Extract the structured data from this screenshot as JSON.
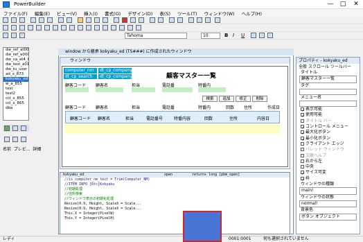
{
  "window": {
    "title": "PowerBuilder",
    "min": "—",
    "max": "□",
    "close": "✕"
  },
  "menu": [
    "ファイル(F)",
    "編集(E)",
    "ビュー(V)",
    "挿入(I)",
    "書式(O)",
    "デザイン(D)",
    "表(S)",
    "ツール(T)",
    "ウィンドウ(W)",
    "ヘルプ(H)"
  ],
  "toolbar": {
    "font": "Tahoma",
    "size": "10"
  },
  "tree": [
    "dw_ref_at00.srw",
    "dw_ref_a0002",
    "dw_ca_at4_tsl",
    "dw_test_a01",
    "dw_tu_user",
    "ad_x_873",
    "kokyaku_ed",
    "w_a_855",
    "test",
    "test2",
    "ccl_x_855",
    "ccl_x_865",
    "dba"
  ],
  "tree_selected": 6,
  "left_panel": {
    "label1": "名前",
    "label2": "プレビ...",
    "label3": "詳細"
  },
  "inner": {
    "title": "window から継承 kokyaku_ed (TS###) に作成されたウィンドウ",
    "left_name": "ウィンドウ"
  },
  "form": {
    "title": "顧客マスター一覧",
    "tabs": [
      "computer_nm",
      "dt_cp_company_"
    ],
    "tab2": [
      "dt_cp_search",
      "dt_cp_company_"
    ],
    "row1": [
      "顧客コード",
      "顧客名",
      "担当",
      "電話番",
      "特番内"
    ],
    "row2": [
      "顧客コード",
      "顧客名",
      "担当",
      "電話番",
      "特番内",
      "回数",
      "住所",
      "作成日"
    ],
    "buttons": [
      "検索",
      "追加",
      "修正",
      "削除"
    ],
    "grid_headers": [
      "顧客コード",
      "顧客名",
      "担当",
      "電話番号",
      "特番内容",
      "回数",
      "住所",
      "内容日"
    ]
  },
  "code": {
    "header": "kokyaku_ed",
    "event": "open",
    "return": "returns long [pbm_open]",
    "lines": [
      "//is_computer_nm_text = Trim(Computer_NM)",
      "//ITEM INFO [Rtc]Kokyaku",
      "",
      "//初期処理",
      "//住所検索",
      "//ウィンドウ表示の初期化処理",
      "",
      "Resize(0.9, Height, ScaleX = Scale...",
      "Resize(0.9, Height, ScaleX = Scale...",
      "This.X = Integer(PixelW)",
      "This.Y = Integer(PixelH)"
    ]
  },
  "props": {
    "title": "プロパティ - kokyaku_ed",
    "tabs": [
      "全般",
      "スクロール",
      "ツールバー"
    ],
    "fields": [
      "タイトル",
      "顧客マスター一覧",
      "タグ",
      "",
      "メニュー名"
    ],
    "checks": [
      {
        "label": "表示可能",
        "on": true
      },
      {
        "label": "使用可能",
        "on": true
      },
      {
        "label": "タイトル バー",
        "on": false
      },
      {
        "label": "コントロール メニュー",
        "on": true
      },
      {
        "label": "最大化ボタン",
        "on": true
      },
      {
        "label": "最小化ボタン",
        "on": true
      },
      {
        "label": "クライアント エッジ",
        "on": false
      },
      {
        "label": "パレット ウィンドウ",
        "on": false
      },
      {
        "label": "文脈ヘルプ",
        "on": false
      },
      {
        "label": "右から左",
        "on": false
      },
      {
        "label": "中央",
        "on": false
      },
      {
        "label": "サイズ可変",
        "on": true
      },
      {
        "label": "枠",
        "on": true
      }
    ],
    "wintype_label": "ウィンドウの種類",
    "wintype": "main!",
    "winstate_label": "ウィンドウの状態",
    "winstate": "normal!",
    "bgcolor_label": "背景色",
    "bgcolor": "ボタン オブジェクト"
  },
  "status": {
    "left": "レディ",
    "mid": "0001:0001",
    "right": "何も選択されていません"
  },
  "colors": {
    "accent": "#2a6fd6",
    "cyan": "#00a0d8",
    "green": "#c2eec2",
    "yellow": "#ffffc2",
    "marker": "#4a74d6"
  }
}
